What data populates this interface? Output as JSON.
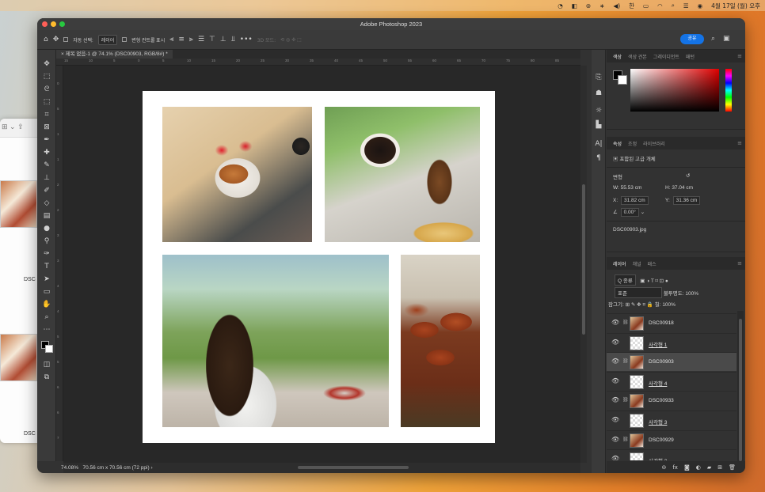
{
  "menubar": {
    "items": [
      "◔",
      "◧",
      "⊚",
      "∗",
      "◀)",
      "한",
      "▭",
      "◠",
      "⌕",
      "☰",
      "◉"
    ],
    "datetime": "4월 17일 (월) 오후"
  },
  "finder_bg": {
    "labels": [
      "DSC",
      "DSC"
    ]
  },
  "window": {
    "title": "Adobe Photoshop 2023"
  },
  "options_bar": {
    "auto_select_label": "자동 선택:",
    "auto_select_value": "레이어",
    "transform_controls_label": "변형 컨트롤 표시",
    "more_label": "•••",
    "mode_3d_label": "3D 모드:",
    "share_label": "공유"
  },
  "document_tab": {
    "label": "제목 없음-1 @ 74.1% (DSC00903, RGB/8#) *"
  },
  "ruler": {
    "top_ticks": [
      "15",
      "10",
      "5",
      "0",
      "5",
      "10",
      "15",
      "20",
      "25",
      "30",
      "35",
      "40",
      "45",
      "50",
      "55",
      "60",
      "65",
      "70",
      "75",
      "80",
      "85"
    ],
    "left_ticks": [
      "0",
      "5",
      "1",
      "1",
      "2",
      "2",
      "3",
      "3",
      "4",
      "4",
      "5",
      "5",
      "6",
      "6",
      "7"
    ]
  },
  "status": {
    "zoom": "74.08%",
    "doc_size": "70.56 cm x 70.56 cm (72 ppi)"
  },
  "photos": [
    "croissant-photo",
    "coffee-photo",
    "woman-photo",
    "bread-photo"
  ],
  "color_panel": {
    "tabs": [
      "색상",
      "색상 견본",
      "그레이디언트",
      "패턴"
    ]
  },
  "properties_panel": {
    "tabs": [
      "속성",
      "조정",
      "라이브러리"
    ],
    "object_type": "포함된 고급 개체",
    "transform_label": "변형",
    "w_label": "W:",
    "w_value": "55.53 cm",
    "h_label": "H:",
    "h_value": "37.04 cm",
    "x_label": "X:",
    "x_value": "31.82 cm",
    "y_label": "Y:",
    "y_value": "31.36 cm",
    "angle_value": "0.00°",
    "filename": "DSC00903.jpg"
  },
  "layers_panel": {
    "tabs": [
      "레이어",
      "채널",
      "패스"
    ],
    "filter_label": "Q 종류",
    "blend_mode": "표준",
    "opacity_label": "불투명도:",
    "opacity_value": "100%",
    "lock_label": "잠그기:",
    "fill_label": "칠:",
    "fill_value": "100%",
    "layers": [
      {
        "name": "DSC00918",
        "type": "image",
        "selected": false
      },
      {
        "name": "사각형 1",
        "type": "shape",
        "selected": false
      },
      {
        "name": "DSC00903",
        "type": "image",
        "selected": true
      },
      {
        "name": "사각형 4",
        "type": "shape",
        "selected": false
      },
      {
        "name": "DSC00933",
        "type": "image",
        "selected": false
      },
      {
        "name": "사각형 3",
        "type": "shape",
        "selected": false
      },
      {
        "name": "DSC00929",
        "type": "image",
        "selected": false
      },
      {
        "name": "사각형 2",
        "type": "shape",
        "selected": false
      }
    ]
  },
  "colors": {
    "accent": "#1473e6",
    "panel_bg": "#323232"
  }
}
